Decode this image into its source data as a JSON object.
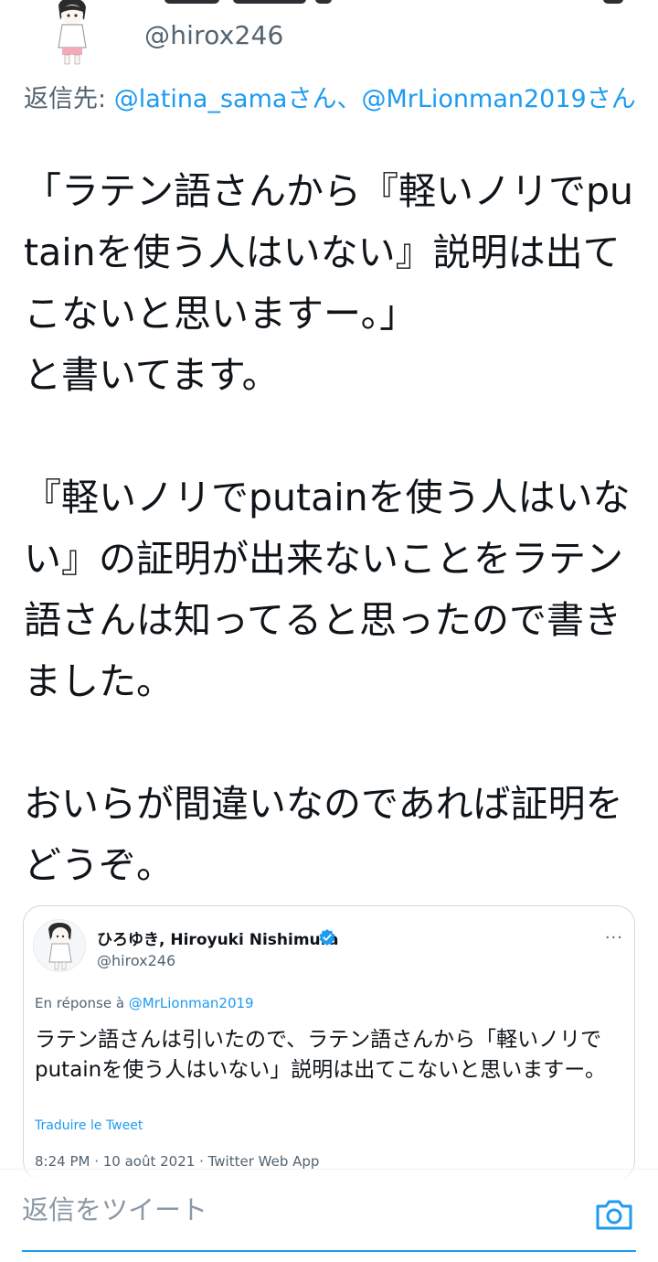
{
  "author": {
    "handle": "@hirox246"
  },
  "reply_to": {
    "prefix": "返信先: ",
    "mention1": "@latina_sama",
    "suffix1": "さん、",
    "mention2": "@MrLionman2019",
    "suffix2": "さん"
  },
  "tweet": {
    "text": "「ラテン語さんから『軽いノリでputainを使う人はいない』説明は出てこないと思いますー。」\nと書いてます。\n\n『軽いノリでputainを使う人はいない』の証明が出来ないことをラテン語さんは知ってると思ったので書きました。\n\nおいらが間違いなのであれば証明をどうぞ。"
  },
  "quoted_tweet": {
    "name": "ひろゆき, Hiroyuki Nishimura",
    "handle": "@hirox246",
    "more": "···",
    "in_reply_prefix": "En réponse à ",
    "in_reply_mention": "@MrLionman2019",
    "text": "ラテン語さんは引いたので、ラテン語さんから「軽いノリでputainを使う人はいない」説明は出てこないと思いますー。",
    "translate": "Traduire le Tweet",
    "meta": "8:24 PM · 10 août 2021 · Twitter Web App"
  },
  "compose": {
    "placeholder": "返信をツイート"
  },
  "colors": {
    "accent": "#1d9bf0",
    "secondary_text": "#536471",
    "primary_text": "#0f1419"
  }
}
